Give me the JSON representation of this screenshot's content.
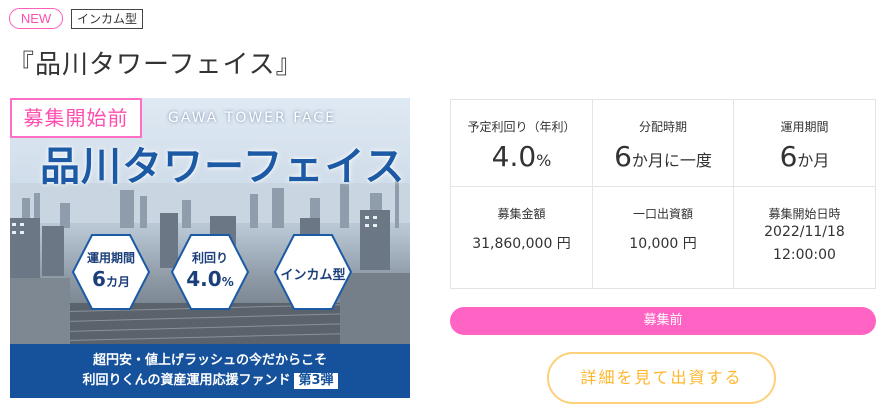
{
  "header": {
    "new_tag": "NEW",
    "type_tag": "インカム型",
    "title": "『品川タワーフェイス』"
  },
  "banner": {
    "status_stamp": "募集開始前",
    "subtitle": "GAWA TOWER FACE",
    "title": "品川タワーフェイス",
    "hex_period_label": "運用期間",
    "hex_period_value": "6",
    "hex_period_unit": "カ月",
    "hex_yield_label": "利回り",
    "hex_yield_value": "4.0",
    "hex_yield_unit": "%",
    "hex_type_label": "インカム型",
    "bottom_line1": "超円安・値上げラッシュの今だからこそ",
    "bottom_line2": "利回りくんの資産運用応援ファンド",
    "bottom_badge": "第3弾"
  },
  "info": {
    "yield_label": "予定利回り（年利）",
    "yield_value": "4.0",
    "yield_unit": "%",
    "dist_label": "分配時期",
    "dist_value": "6",
    "dist_unit": "か月に一度",
    "period_label": "運用期間",
    "period_value": "6",
    "period_unit": "か月",
    "amount_label": "募集金額",
    "amount_value": "31,860,000 円",
    "unit_label": "一口出資額",
    "unit_value": "10,000 円",
    "start_label": "募集開始日時",
    "start_date": "2022/11/18",
    "start_time": "12:00:00"
  },
  "status_bar": "募集前",
  "detail_button": "詳細を見て出資する",
  "colors": {
    "pink": "#ff63c3",
    "brand_blue": "#16529b",
    "button_orange": "#ffb62d"
  }
}
